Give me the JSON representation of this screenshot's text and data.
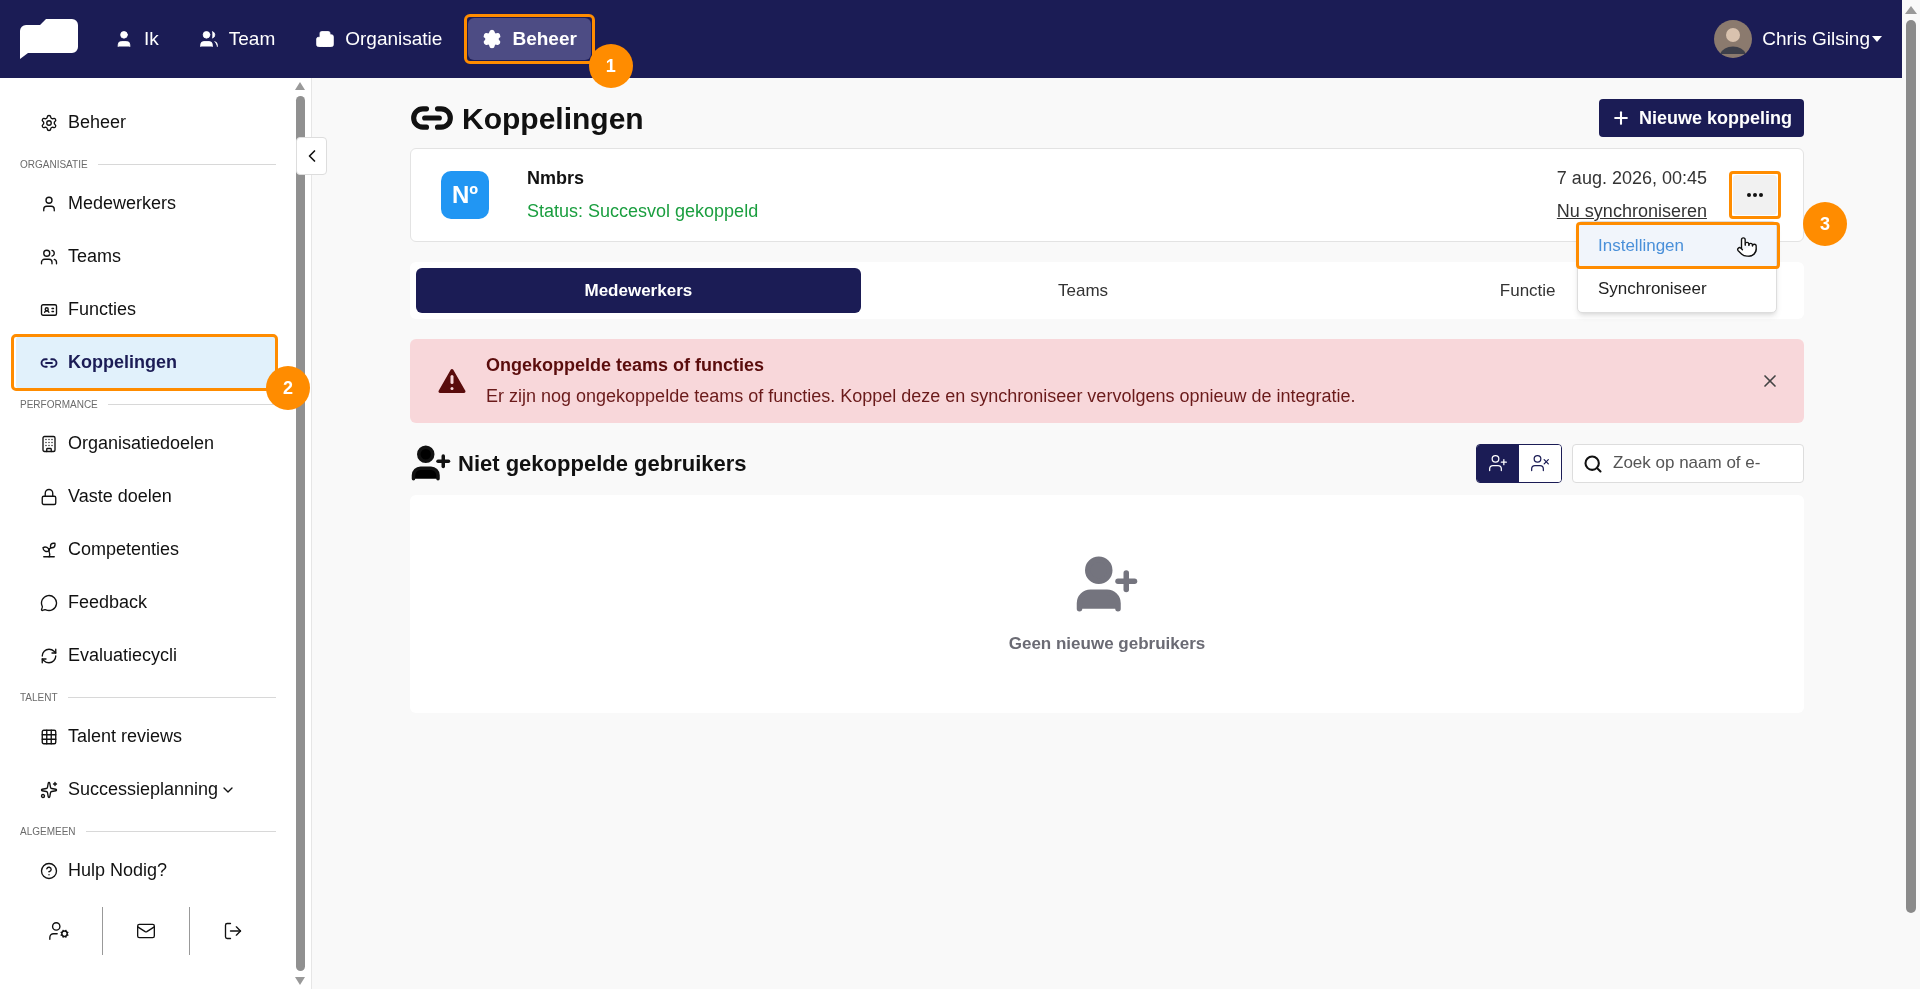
{
  "top_nav": {
    "items": [
      {
        "label": "Ik",
        "selected": false
      },
      {
        "label": "Team",
        "selected": false
      },
      {
        "label": "Organisatie",
        "selected": false
      },
      {
        "label": "Beheer",
        "selected": true,
        "callout": "1"
      }
    ],
    "user": {
      "name": "Chris Gilsing"
    }
  },
  "sidebar": {
    "sections": [
      {
        "items": [
          {
            "label": "Beheer",
            "selected": false,
            "kind": "link"
          }
        ]
      },
      {
        "heading": "ORGANISATIE",
        "items": [
          {
            "label": "Medewerkers",
            "selected": false,
            "kind": "link"
          },
          {
            "label": "Teams",
            "selected": false,
            "kind": "link"
          },
          {
            "label": "Functies",
            "selected": false,
            "kind": "link"
          },
          {
            "label": "Koppelingen",
            "selected": true,
            "kind": "link",
            "callout": "2"
          }
        ]
      },
      {
        "heading": "PERFORMANCE",
        "items": [
          {
            "label": "Organisatiedoelen",
            "selected": false,
            "kind": "link"
          },
          {
            "label": "Vaste doelen",
            "selected": false,
            "kind": "link"
          },
          {
            "label": "Competenties",
            "selected": false,
            "kind": "link"
          },
          {
            "label": "Feedback",
            "selected": false,
            "kind": "link"
          },
          {
            "label": "Evaluatiecycli",
            "selected": false,
            "kind": "link"
          }
        ]
      },
      {
        "heading": "TALENT",
        "items": [
          {
            "label": "Talent reviews",
            "selected": false,
            "kind": "link"
          },
          {
            "label": "Successieplanning",
            "selected": false,
            "kind": "group",
            "expanded": false
          }
        ]
      },
      {
        "heading": "ALGEMEEN",
        "items": [
          {
            "label": "Hulp Nodig?",
            "selected": false,
            "kind": "link"
          }
        ]
      }
    ]
  },
  "page": {
    "title": "Koppelingen",
    "new_button": "Nieuwe koppeling",
    "integration": {
      "logo_text": "Nº",
      "name": "Nmbrs",
      "status": "Status: Succesvol gekoppeld",
      "date": "7 aug. 2026, 00:45",
      "sync_link": "Nu synchroniseren"
    },
    "more_menu": {
      "callout": "3",
      "items": [
        {
          "label": "Instellingen",
          "selected": true
        },
        {
          "label": "Synchroniseer",
          "selected": false
        }
      ]
    },
    "tabs": [
      {
        "label": "Medewerkers",
        "selected": true
      },
      {
        "label": "Teams",
        "selected": false
      },
      {
        "label": "Functie",
        "selected": false
      }
    ],
    "alert": {
      "title": "Ongekoppelde teams of functies",
      "message": "Er zijn nog ongekoppelde teams of functies. Koppel deze en synchroniseer vervolgens opnieuw de integratie."
    },
    "section": {
      "title": "Niet gekoppelde gebruikers",
      "view_toggle": [
        {
          "selected": true
        },
        {
          "selected": false
        }
      ],
      "search": {
        "placeholder": "Zoek op naam of e-"
      }
    },
    "empty": {
      "text": "Geen nieuwe gebruikers"
    }
  }
}
